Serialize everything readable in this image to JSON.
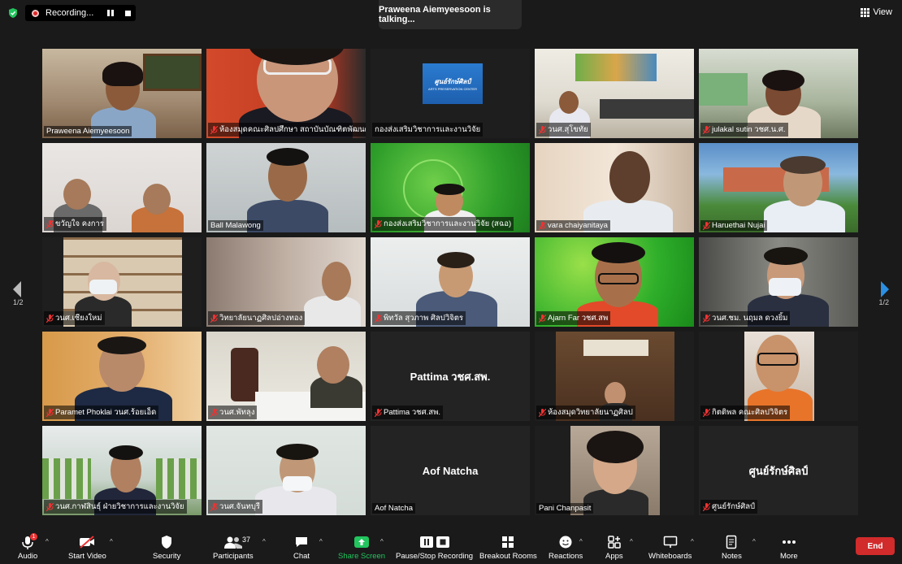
{
  "top": {
    "recording_label": "Recording...",
    "talking": "Praweena Aiemyeesoon is talking...",
    "view_label": "View"
  },
  "paging": {
    "left_label": "1/2",
    "right_label": "1/2"
  },
  "participants": [
    {
      "name": "Praweena Aiemyeesoon",
      "muted": false
    },
    {
      "name": "ห้องสมุดคณะศิลปศึกษา สถาบันบัณฑิตพัฒนศ...",
      "muted": true
    },
    {
      "name": "กองส่งเสริมวิชาการและงานวิจัย",
      "muted": false,
      "logo_text": "ศูนย์รักษ์ศิลป์",
      "logo_sub": "ARTS PRESERVATION CENTER"
    },
    {
      "name": "วนศ.สุโขทัย",
      "muted": true
    },
    {
      "name": "julakal sutin วชศ.น.ศ.",
      "muted": true
    },
    {
      "name": "ขวัญใจ คงการ",
      "muted": true
    },
    {
      "name": "Ball Malawong",
      "muted": false
    },
    {
      "name": "กองส่งเสริมวิชาการและงานวิจัย (สฉอ)",
      "muted": true
    },
    {
      "name": "vara chaiyanitaya",
      "muted": true
    },
    {
      "name": "Haruethai Nujai",
      "muted": true
    },
    {
      "name": "วนศ.เชียงใหม่",
      "muted": true
    },
    {
      "name": "วิทยาลัยนาฏศิลปอ่างทอง",
      "muted": true
    },
    {
      "name": "พิทวัล สุวภาพ ศิลปวิจิตร",
      "muted": true
    },
    {
      "name": "Ajarn Far วชศ.สพ",
      "muted": true
    },
    {
      "name": "วนศ.ชม. นฤมล  ดวงยิ้ม",
      "muted": true
    },
    {
      "name": "Paramet Phoklai วนศ.ร้อยเอ็ด",
      "muted": true
    },
    {
      "name": "วนศ.พัทลุง",
      "muted": true
    },
    {
      "name": "Pattima วชศ.สพ.",
      "muted": true,
      "big_name": "Pattima วชศ.สพ."
    },
    {
      "name": "ห้องสมุดวิทยาลัยนาฏศิลป",
      "muted": true
    },
    {
      "name": "กิตติพล คณะศิลปวิจิตร",
      "muted": true
    },
    {
      "name": "วนศ.กาฬสินธุ์ ฝ่ายวิชาการและงานวิจัย",
      "muted": true
    },
    {
      "name": "วนศ.จันทบุรี",
      "muted": true
    },
    {
      "name": "Aof Natcha",
      "muted": false,
      "big_name": "Aof Natcha"
    },
    {
      "name": "Pani Chanpasit",
      "muted": false
    },
    {
      "name": "ศูนย์รักษ์ศิลป์",
      "muted": true,
      "big_name": "ศูนย์รักษ์ศิลป์"
    }
  ],
  "toolbar": {
    "audio": "Audio",
    "start_video": "Start Video",
    "security": "Security",
    "participants": "Participants",
    "participants_count": "37",
    "chat": "Chat",
    "share_screen": "Share Screen",
    "pause_stop": "Pause/Stop Recording",
    "breakout": "Breakout Rooms",
    "reactions": "Reactions",
    "apps": "Apps",
    "whiteboards": "Whiteboards",
    "notes": "Notes",
    "more": "More",
    "end": "End",
    "audio_badge": "1"
  },
  "colors": {
    "active_border": "#d8e32c",
    "share_green": "#22c55e",
    "end_red": "#d12b2b",
    "mute_red": "#e33"
  }
}
